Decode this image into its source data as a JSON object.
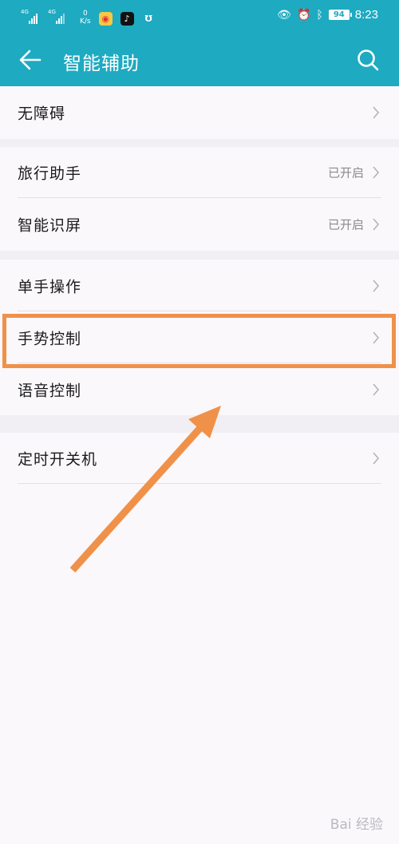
{
  "status_bar": {
    "signal_1_tag": "4G",
    "signal_2_tag": "4G",
    "net_speed_value": "0",
    "net_speed_unit": "K/s",
    "battery": "94",
    "time": "8:23"
  },
  "app_bar": {
    "title": "智能辅助"
  },
  "menu": {
    "items": [
      {
        "label": "无障碍",
        "status": ""
      },
      {
        "label": "旅行助手",
        "status": "已开启"
      },
      {
        "label": "智能识屏",
        "status": "已开启"
      },
      {
        "label": "单手操作",
        "status": ""
      },
      {
        "label": "手势控制",
        "status": ""
      },
      {
        "label": "语音控制",
        "status": ""
      },
      {
        "label": "定时开关机",
        "status": ""
      }
    ]
  },
  "annotation": {
    "highlight_color": "#f0914a"
  },
  "colors": {
    "accent": "#1eaac1",
    "background": "#faf8fb",
    "section_gap": "#f1eff3"
  },
  "watermark": {
    "text": "Bai 经验"
  }
}
